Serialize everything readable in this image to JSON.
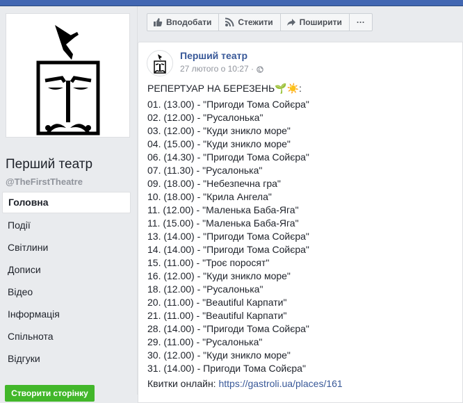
{
  "sidebar": {
    "page_name": "Перший театр",
    "page_handle": "@TheFirstTheatre",
    "items": [
      {
        "label": "Головна"
      },
      {
        "label": "Події"
      },
      {
        "label": "Світлини"
      },
      {
        "label": "Дописи"
      },
      {
        "label": "Відео"
      },
      {
        "label": "Інформація"
      },
      {
        "label": "Спільнота"
      },
      {
        "label": "Відгуки"
      }
    ],
    "create_page_label": "Створити сторінку"
  },
  "actions": {
    "like_label": "Вподобати",
    "follow_label": "Стежити",
    "share_label": "Поширити",
    "more_label": "···"
  },
  "post": {
    "author": "Перший театр",
    "timestamp": "27 лютого о 10:27 ·",
    "title": "РЕПЕРТУАР НА БЕРЕЗЕНЬ🌱☀️:",
    "lines": [
      "01. (13.00) - \"Пригоди Тома Сойєра\"",
      "02. (12.00) - \"Русалонька\"",
      "03. (12.00) - \"Куди зникло море\"",
      "04. (15.00) - \"Куди зникло море\"",
      "06. (14.30) - \"Пригоди Тома Сойєра\"",
      "07. (11.30) - \"Русалонька\"",
      "09. (18.00) - \"Небезпечна гра\"",
      "10. (18.00) - \"Крила Ангела\"",
      "11. (12.00) - \"Маленька Баба-Яга\"",
      "11. (15.00) - \"Маленька Баба-Яга\"",
      "13. (14.00) - \"Пригоди Тома Сойєра\"",
      "14. (14.00) - \"Пригоди Тома Сойєра\"",
      "15. (11.00) - \"Троє поросят\"",
      "16. (12.00) - \"Куди зникло море\"",
      "18. (12.00) - \"Русалонька\"",
      "20. (11.00) - \"Beautiful Карпати\"",
      "21. (11.00) - \"Beautiful Карпати\"",
      "28. (14.00) - \"Пригоди Тома Сойєра\"",
      "29. (11.00) - \"Русалонька\"",
      "30. (12.00) - \"Куди зникло море\"",
      "31. (14.00) - Пригоди Тома Сойєра\""
    ],
    "tickets_label": "Квитки онлайн:",
    "tickets_link": "https://gastroli.ua/places/161"
  },
  "icons": {
    "like": "thumbs-up-icon",
    "follow": "rss-icon",
    "share": "share-arrow-icon",
    "privacy": "globe-icon"
  },
  "colors": {
    "brand_blue": "#4267b2",
    "link": "#385898",
    "create_green": "#42b72a"
  }
}
